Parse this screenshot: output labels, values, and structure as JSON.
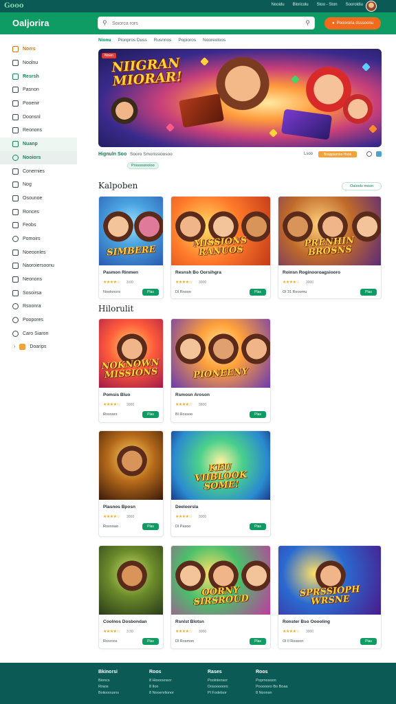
{
  "topbar": {
    "logo": "Gooo",
    "links": [
      "Nooidu",
      "Bloricolu",
      "Stoo - Ston",
      "Sooroldiu"
    ]
  },
  "header": {
    "brand": "Oaljorira",
    "search_placeholder": "Soiorca rors",
    "cta_label": "Pooororia dsssoonu"
  },
  "sidebar": {
    "items": [
      {
        "label": "Norrs",
        "style": "hl"
      },
      {
        "label": "Noolnu",
        "style": ""
      },
      {
        "label": "Resrsh",
        "style": "grn"
      },
      {
        "label": "Pasnon",
        "style": ""
      },
      {
        "label": "Pooenir",
        "style": ""
      },
      {
        "label": "Doonsnl",
        "style": ""
      },
      {
        "label": "Reonons",
        "style": ""
      },
      {
        "label": "Nuanp",
        "style": "grn bg1"
      },
      {
        "label": "Nooiors",
        "style": "grn bg2 round"
      },
      {
        "label": "Conernies",
        "style": ""
      },
      {
        "label": "Nog",
        "style": ""
      },
      {
        "label": "Osounoe",
        "style": ""
      },
      {
        "label": "Ronces",
        "style": ""
      },
      {
        "label": "Feobs",
        "style": ""
      },
      {
        "label": "Pomoirs",
        "style": "round"
      },
      {
        "label": "Noeoonles",
        "style": ""
      },
      {
        "label": "Naoroiersoonu",
        "style": ""
      },
      {
        "label": "Neonons",
        "style": ""
      },
      {
        "label": "Sosoirsa",
        "style": ""
      },
      {
        "label": "Rsoonra",
        "style": "round"
      },
      {
        "label": "Poopores",
        "style": "round"
      },
      {
        "label": "Caro Siaron",
        "style": "round"
      },
      {
        "label": "Doarips",
        "style": "sub"
      }
    ]
  },
  "tabs": [
    "Nionu",
    "Pionpros Duss",
    "Rusnnos",
    "Popioros",
    "Nooreoloos"
  ],
  "hero": {
    "badge": "Nown",
    "title": "NIIGRAN\nMIORAR!",
    "game_name": "Hignuln Soo",
    "subtitle": "Sooro Smorissioosoo",
    "rating_text": "Lsoo",
    "pill": "Bosppssnoo Hsos",
    "tag": "Prssooonoioo"
  },
  "section1": {
    "title": "Kalpoben",
    "view_all": "Oaloolo mosn",
    "cards": [
      {
        "thumb": "SIMBERE",
        "name": "Pasmon Rinmen",
        "rating": "3:00",
        "meta": "Noolonors"
      },
      {
        "thumb": "MISSIONS\nRANUOS",
        "name": "Resnsh Bo Oorsihgra",
        "rating": "3000",
        "meta": "Dl Rnooo"
      },
      {
        "thumb": "PRENHIN\nBROSNS",
        "name": "Roinsn Roginooroagsiooro",
        "rating": "3000",
        "meta": "Ol 31 Reoomu"
      }
    ]
  },
  "section2": {
    "title": "Hilorulit",
    "cards": [
      {
        "thumb": "NOKNOWN\nMISSIONS",
        "name": "Pomsis Bluo",
        "rating": "3000",
        "meta": "Rosnors"
      },
      {
        "thumb": "PIONEENY",
        "name": "Rsmosn Aroson",
        "rating": "3800",
        "meta": "Bl Rossoo"
      },
      {
        "thumb": "",
        "name": "Plasnos Bposn",
        "rating": "3000",
        "meta": "Rosnoao"
      },
      {
        "thumb": "KEU\nVIIBLOOK\nSOME!",
        "name": "Deeloorsla",
        "rating": "3000",
        "meta": "Dl Pasoo"
      },
      {
        "thumb": "",
        "name": "Coolnos Dosbondan",
        "rating": "3:30",
        "meta": "Rsnrnos"
      },
      {
        "thumb": "OORNY\nSIRSROUD",
        "name": "Rsnlst Blotsn",
        "rating": "3000",
        "meta": "Dl Rosmon"
      },
      {
        "thumb": "SPRSSIOPH\nWRSNE",
        "name": "Ronster Bso Ooooling",
        "rating": "3000",
        "meta": "Ol Il Rosoon"
      }
    ]
  },
  "common": {
    "play_label": "Plas",
    "stars": "★★★★☆"
  },
  "footer": {
    "cols": [
      {
        "head": "Bkinorsi",
        "links": [
          "Bioncs",
          "Rraos",
          "Boiiooousns"
        ]
      },
      {
        "head": "Roos",
        "links": [
          "8 Hiooosnsor",
          "8 Ilon",
          "8 Nooenrlionor"
        ]
      },
      {
        "head": "Rases",
        "links": [
          "Poolnlensor",
          "Dosooooors",
          "Pl Fodelsor"
        ]
      },
      {
        "head": "Roos",
        "links": [
          "Poprnosoon",
          "Poooooro Bo Boaa",
          "8 Noonsn"
        ]
      }
    ]
  },
  "colors": {
    "brand_green": "#0e9c64",
    "dark_teal": "#0b5a56",
    "accent_orange": "#f26b1d",
    "star": "#f2a91d"
  }
}
